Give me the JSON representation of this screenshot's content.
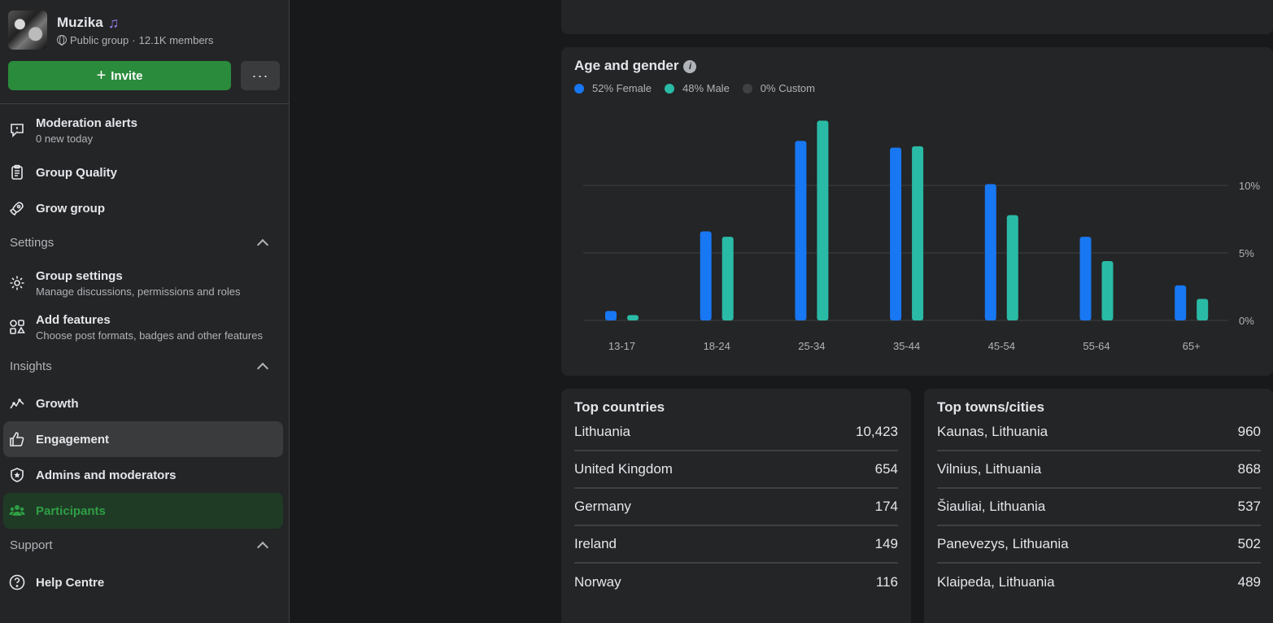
{
  "group": {
    "name": "Muzika",
    "note_icon": "music-note-icon",
    "privacy": "Public group",
    "members": "12.1K members"
  },
  "actions": {
    "invite_label": "Invite",
    "more_label": "···"
  },
  "nav": {
    "moderation": {
      "label": "Moderation alerts",
      "sub": "0 new today"
    },
    "quality": {
      "label": "Group Quality"
    },
    "grow": {
      "label": "Grow group"
    },
    "settings_section": "Settings",
    "group_settings": {
      "label": "Group settings",
      "sub": "Manage discussions, permissions and roles"
    },
    "add_features": {
      "label": "Add features",
      "sub": "Choose post formats, badges and other features"
    },
    "insights_section": "Insights",
    "growth": {
      "label": "Growth"
    },
    "engagement": {
      "label": "Engagement"
    },
    "admins": {
      "label": "Admins and moderators"
    },
    "participants": {
      "label": "Participants"
    },
    "support_section": "Support",
    "help": {
      "label": "Help Centre"
    }
  },
  "age_card": {
    "title": "Age and gender",
    "info": "i",
    "legend": [
      {
        "label": "52% Female",
        "color": "#1877f2"
      },
      {
        "label": "48% Male",
        "color": "#2abba7"
      },
      {
        "label": "0% Custom",
        "color": "#3e4042"
      }
    ]
  },
  "chart_data": {
    "type": "bar",
    "title": "Age and gender",
    "categories": [
      "13-17",
      "18-24",
      "25-34",
      "35-44",
      "45-54",
      "55-64",
      "65+"
    ],
    "series": [
      {
        "name": "52% Female",
        "color": "#1877f2",
        "values": [
          0.7,
          6.6,
          13.3,
          12.8,
          10.1,
          6.2,
          2.6
        ]
      },
      {
        "name": "48% Male",
        "color": "#2abba7",
        "values": [
          0.4,
          6.2,
          14.8,
          12.9,
          7.8,
          4.4,
          1.6
        ]
      }
    ],
    "yticks": [
      "0%",
      "5%",
      "10%"
    ],
    "ytick_values": [
      0,
      5,
      10
    ],
    "ylim": [
      0,
      15
    ],
    "grid": true,
    "legend": "top-left"
  },
  "countries": {
    "title": "Top countries",
    "rows": [
      {
        "name": "Lithuania",
        "value": "10,423"
      },
      {
        "name": "United Kingdom",
        "value": "654"
      },
      {
        "name": "Germany",
        "value": "174"
      },
      {
        "name": "Ireland",
        "value": "149"
      },
      {
        "name": "Norway",
        "value": "116"
      }
    ]
  },
  "cities": {
    "title": "Top towns/cities",
    "rows": [
      {
        "name": "Kaunas, Lithuania",
        "value": "960"
      },
      {
        "name": "Vilnius, Lithuania",
        "value": "868"
      },
      {
        "name": "Šiauliai, Lithuania",
        "value": "537"
      },
      {
        "name": "Panevezys, Lithuania",
        "value": "502"
      },
      {
        "name": "Klaipeda, Lithuania",
        "value": "489"
      }
    ]
  }
}
